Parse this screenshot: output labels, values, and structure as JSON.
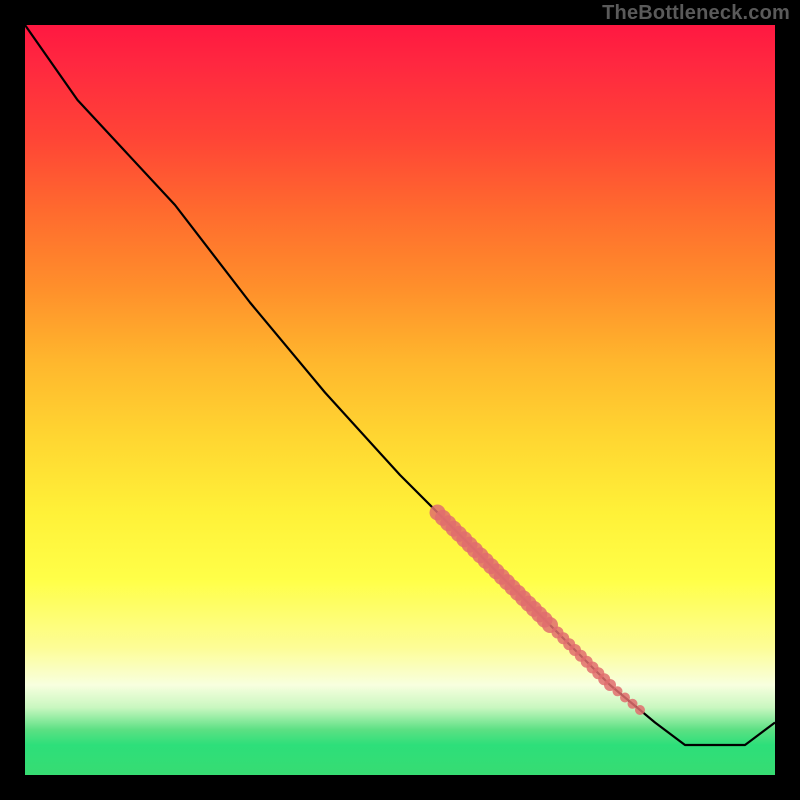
{
  "watermark": "TheBottleneck.com",
  "chart_data": {
    "type": "line",
    "title": "",
    "xlabel": "",
    "ylabel": "",
    "xlim": [
      0,
      100
    ],
    "ylim": [
      0,
      100
    ],
    "grid": false,
    "background": "gradient-red-yellow-green",
    "series": [
      {
        "name": "bottleneck-curve",
        "stroke": "#000000",
        "x": [
          0,
          7,
          20,
          30,
          40,
          50,
          58,
          66,
          72,
          78,
          84,
          88,
          96,
          100
        ],
        "y": [
          100,
          90,
          76,
          63,
          51,
          40,
          32,
          24,
          18,
          12,
          7,
          4,
          4,
          7
        ]
      }
    ],
    "highlights": [
      {
        "name": "density-1",
        "x_range": [
          55,
          70
        ],
        "y_range": [
          20,
          35
        ],
        "weight": "heavy"
      },
      {
        "name": "density-2",
        "x_range": [
          71,
          78
        ],
        "y_range": [
          11,
          19
        ],
        "weight": "medium"
      },
      {
        "name": "density-3",
        "x_range": [
          79,
          82
        ],
        "y_range": [
          8,
          11
        ],
        "weight": "light"
      }
    ],
    "colors": {
      "top": "#ff1841",
      "mid": "#fff138",
      "bottom": "#37dc72",
      "highlight": "#e06d6d"
    }
  }
}
